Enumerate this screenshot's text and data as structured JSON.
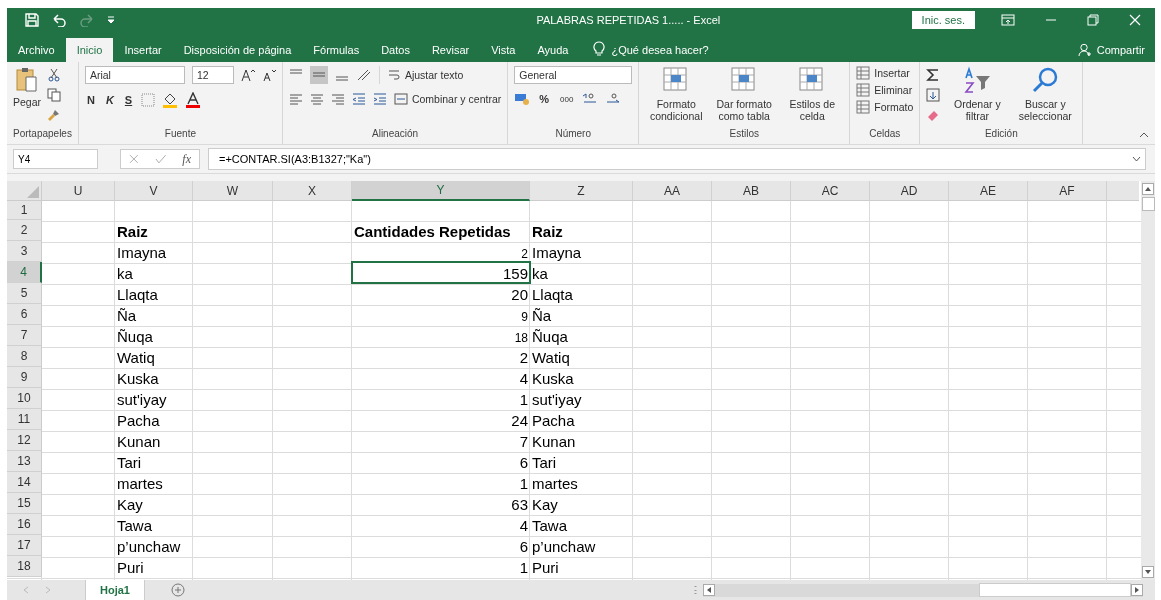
{
  "title_bar": {
    "title": "PALABRAS REPETIDAS 1.....  -  Excel",
    "sign_in": "Inic. ses."
  },
  "tabs": [
    {
      "label": "Archivo",
      "selected": false
    },
    {
      "label": "Inicio",
      "selected": true
    },
    {
      "label": "Insertar",
      "selected": false
    },
    {
      "label": "Disposición de página",
      "selected": false
    },
    {
      "label": "Fórmulas",
      "selected": false
    },
    {
      "label": "Datos",
      "selected": false
    },
    {
      "label": "Revisar",
      "selected": false
    },
    {
      "label": "Vista",
      "selected": false
    },
    {
      "label": "Ayuda",
      "selected": false
    }
  ],
  "tell_me": "¿Qué desea hacer?",
  "share": "Compartir",
  "ribbon": {
    "clipboard": {
      "label": "Portapapeles",
      "paste": "Pegar"
    },
    "font": {
      "label": "Fuente",
      "font_name": "Arial",
      "font_size": "12",
      "bold": "N",
      "italic": "K",
      "underline": "S"
    },
    "alignment": {
      "label": "Alineación",
      "wrap_text": "Ajustar texto",
      "merge": "Combinar y centrar"
    },
    "number": {
      "label": "Número",
      "format": "General",
      "percent": "%",
      "thousands": "000"
    },
    "styles": {
      "label": "Estilos",
      "buttons": [
        "Formato condicional",
        "Dar formato como tabla",
        "Estilos de celda"
      ]
    },
    "cells": {
      "label": "Celdas",
      "buttons": [
        "Insertar",
        "Eliminar",
        "Formato"
      ]
    },
    "editing": {
      "label": "Edición",
      "buttons": [
        "Ordenar y filtrar",
        "Buscar y seleccionar"
      ]
    }
  },
  "formula_bar": {
    "name_box": "Y4",
    "function_label": "fx",
    "formula": "=+CONTAR.SI(A3:B1327;\"Ka\")"
  },
  "columns": [
    {
      "label": "U",
      "selected": false
    },
    {
      "label": "V",
      "selected": false
    },
    {
      "label": "W",
      "selected": false
    },
    {
      "label": "X",
      "selected": false
    },
    {
      "label": "Y",
      "selected": true
    },
    {
      "label": "Z",
      "selected": false
    },
    {
      "label": "AA",
      "selected": false
    },
    {
      "label": "AB",
      "selected": false
    },
    {
      "label": "AC",
      "selected": false
    },
    {
      "label": "AD",
      "selected": false
    },
    {
      "label": "AE",
      "selected": false
    },
    {
      "label": "AF",
      "selected": false
    }
  ],
  "rows": [
    {
      "number": "1",
      "selected": false,
      "kind": "empty"
    },
    {
      "number": "2",
      "selected": false,
      "kind": "header",
      "raiz": "Raiz",
      "count": "Cantidades Repetidas",
      "raiz_copy": "Raiz"
    },
    {
      "number": "3",
      "selected": false,
      "kind": "data",
      "raiz": "Imayna",
      "count": "2",
      "small": true,
      "raiz_copy": "Imayna"
    },
    {
      "number": "4",
      "selected": true,
      "kind": "data",
      "raiz": "ka",
      "count": "159",
      "small": false,
      "raiz_copy": "ka"
    },
    {
      "number": "5",
      "selected": false,
      "kind": "data",
      "raiz": "Llaqta",
      "count": "20",
      "small": false,
      "raiz_copy": "Llaqta"
    },
    {
      "number": "6",
      "selected": false,
      "kind": "data",
      "raiz": "Ña",
      "count": "9",
      "small": true,
      "raiz_copy": "Ña"
    },
    {
      "number": "7",
      "selected": false,
      "kind": "data",
      "raiz": "Ñuqa",
      "count": "18",
      "small": true,
      "raiz_copy": "Ñuqa"
    },
    {
      "number": "8",
      "selected": false,
      "kind": "data",
      "raiz": "Watiq",
      "count": "2",
      "small": false,
      "raiz_copy": "Watiq"
    },
    {
      "number": "9",
      "selected": false,
      "kind": "data",
      "raiz": "Kuska",
      "count": "4",
      "small": false,
      "raiz_copy": "Kuska"
    },
    {
      "number": "10",
      "selected": false,
      "kind": "data",
      "raiz": "sut'iyay",
      "count": "1",
      "small": false,
      "raiz_copy": "sut'iyay"
    },
    {
      "number": "11",
      "selected": false,
      "kind": "data",
      "raiz": "Pacha",
      "count": "24",
      "small": false,
      "raiz_copy": "Pacha"
    },
    {
      "number": "12",
      "selected": false,
      "kind": "data",
      "raiz": "Kunan",
      "count": "7",
      "small": false,
      "raiz_copy": "Kunan"
    },
    {
      "number": "13",
      "selected": false,
      "kind": "data",
      "raiz": "Tari",
      "count": "6",
      "small": false,
      "raiz_copy": "Tari"
    },
    {
      "number": "14",
      "selected": false,
      "kind": "data",
      "raiz": "martes",
      "count": "1",
      "small": false,
      "raiz_copy": "martes"
    },
    {
      "number": "15",
      "selected": false,
      "kind": "data",
      "raiz": "Kay",
      "count": "63",
      "small": false,
      "raiz_copy": "Kay"
    },
    {
      "number": "16",
      "selected": false,
      "kind": "data",
      "raiz": "Tawa",
      "count": "4",
      "small": false,
      "raiz_copy": "Tawa"
    },
    {
      "number": "17",
      "selected": false,
      "kind": "data",
      "raiz": "p’unchaw",
      "count": "6",
      "small": false,
      "raiz_copy": "p’unchaw"
    },
    {
      "number": "18",
      "selected": false,
      "kind": "data",
      "raiz": "Puri",
      "count": "1",
      "small": false,
      "raiz_copy": "Puri"
    }
  ],
  "sheet_tabs": [
    {
      "label": "Hoja1",
      "selected": true
    }
  ]
}
